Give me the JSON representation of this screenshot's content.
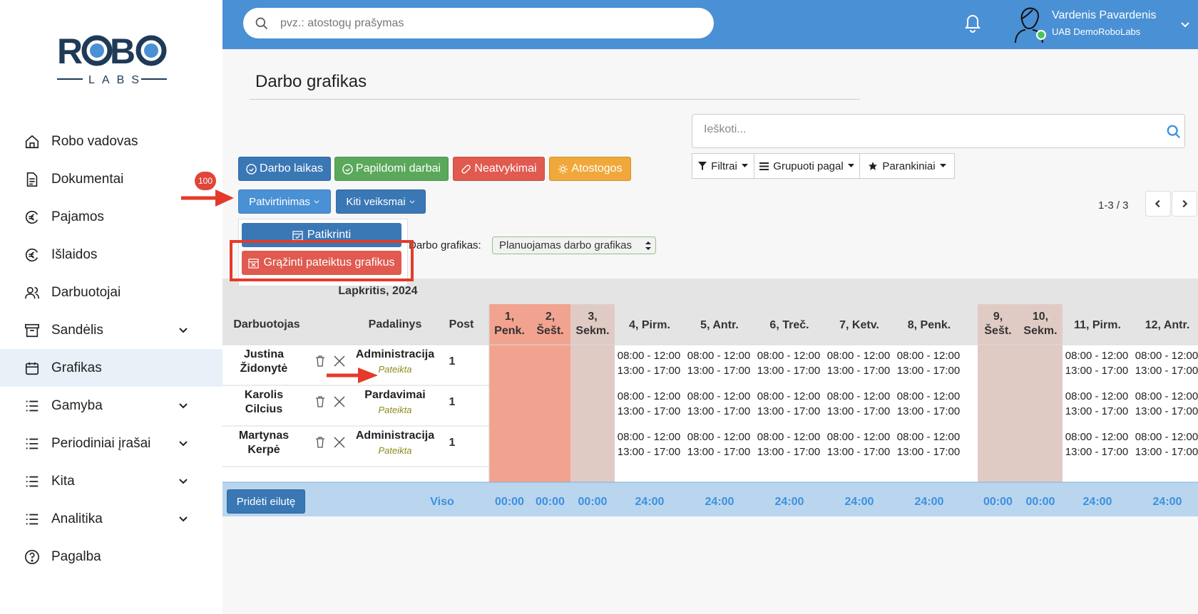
{
  "logo": {
    "top": "ROBO",
    "bottom": "LABS"
  },
  "sidebar": {
    "items": [
      {
        "label": "Robo vadovas",
        "icon": "home-icon",
        "chevron": false
      },
      {
        "label": "Dokumentai",
        "icon": "document-icon",
        "chevron": false
      },
      {
        "label": "Pajamos",
        "icon": "euro-icon",
        "chevron": false
      },
      {
        "label": "Išlaidos",
        "icon": "euro-icon",
        "chevron": false
      },
      {
        "label": "Darbuotojai",
        "icon": "users-icon",
        "chevron": false
      },
      {
        "label": "Sandėlis",
        "icon": "archive-icon",
        "chevron": true
      },
      {
        "label": "Grafikas",
        "icon": "calendar-icon",
        "chevron": false,
        "active": true
      },
      {
        "label": "Gamyba",
        "icon": "list-icon",
        "chevron": true
      },
      {
        "label": "Periodiniai įrašai",
        "icon": "list-icon",
        "chevron": true
      },
      {
        "label": "Kita",
        "icon": "list-icon",
        "chevron": true
      },
      {
        "label": "Analitika",
        "icon": "list-icon",
        "chevron": true
      },
      {
        "label": "Pagalba",
        "icon": "help-icon",
        "chevron": false
      }
    ],
    "badge": "100"
  },
  "topbar": {
    "search_placeholder": "pvz.: atostogų prašymas",
    "user_name": "Vardenis Pavardenis",
    "company": "UAB DemoRoboLabs"
  },
  "page": {
    "title": "Darbo grafikas",
    "search_placeholder": "Ieškoti...",
    "filters_label": "Filtrai",
    "group_label": "Grupuoti pagal",
    "favorites_label": "Parankiniai",
    "pager": "1-3 / 3",
    "buttons": {
      "work_time": "Darbo laikas",
      "extra_work": "Papildomi darbai",
      "absences": "Neatvykimai",
      "vacation": "Atostogos",
      "approval": "Patvirtinimas",
      "other_actions": "Kiti veiksmai"
    },
    "dropdown": {
      "check": "Patikrinti",
      "return": "Grąžinti pateiktus grafikus"
    },
    "schedule_label": "Darbo grafikas:",
    "schedule_value": "Planuojamas darbo grafikas",
    "month": "Lapkritis, 2024",
    "colors": {
      "topbar": "#4a90d4",
      "weekend_red": "#f2a38f",
      "weekend_beige": "#e0cbc4",
      "accent": "#3e8fe0"
    }
  },
  "table": {
    "headers": {
      "employee": "Darbuotojas",
      "department": "Padalinys",
      "post": "Post"
    },
    "days": [
      {
        "l1": "1,",
        "l2": "Penk."
      },
      {
        "l1": "2,",
        "l2": "Šešt."
      },
      {
        "l1": "3,",
        "l2": "Sekm."
      },
      {
        "l1": "4, Pirm.",
        "l2": ""
      },
      {
        "l1": "5, Antr.",
        "l2": ""
      },
      {
        "l1": "6, Treč.",
        "l2": ""
      },
      {
        "l1": "7, Ketv.",
        "l2": ""
      },
      {
        "l1": "8, Penk.",
        "l2": ""
      },
      {
        "l1": "9,",
        "l2": "Šešt."
      },
      {
        "l1": "10,",
        "l2": "Sekm."
      },
      {
        "l1": "11, Pirm.",
        "l2": ""
      },
      {
        "l1": "12, Antr.",
        "l2": ""
      }
    ],
    "rows": [
      {
        "first": "Justina",
        "last": "Židonytė",
        "dept": "Administracija",
        "status": "Pateikta",
        "post": "1"
      },
      {
        "first": "Karolis",
        "last": "Cilcius",
        "dept": "Pardavimai",
        "status": "Pateikta",
        "post": "1"
      },
      {
        "first": "Martynas",
        "last": "Kerpė",
        "dept": "Administracija",
        "status": "Pateikta",
        "post": "1"
      }
    ],
    "shift_am": "08:00 - 12:00",
    "shift_pm": "13:00 - 17:00",
    "add_row": "Pridėti eilutę",
    "total_label": "Viso",
    "totals": [
      "00:00",
      "00:00",
      "00:00",
      "24:00",
      "24:00",
      "24:00",
      "24:00",
      "24:00",
      "00:00",
      "00:00",
      "24:00",
      "24:00"
    ]
  }
}
